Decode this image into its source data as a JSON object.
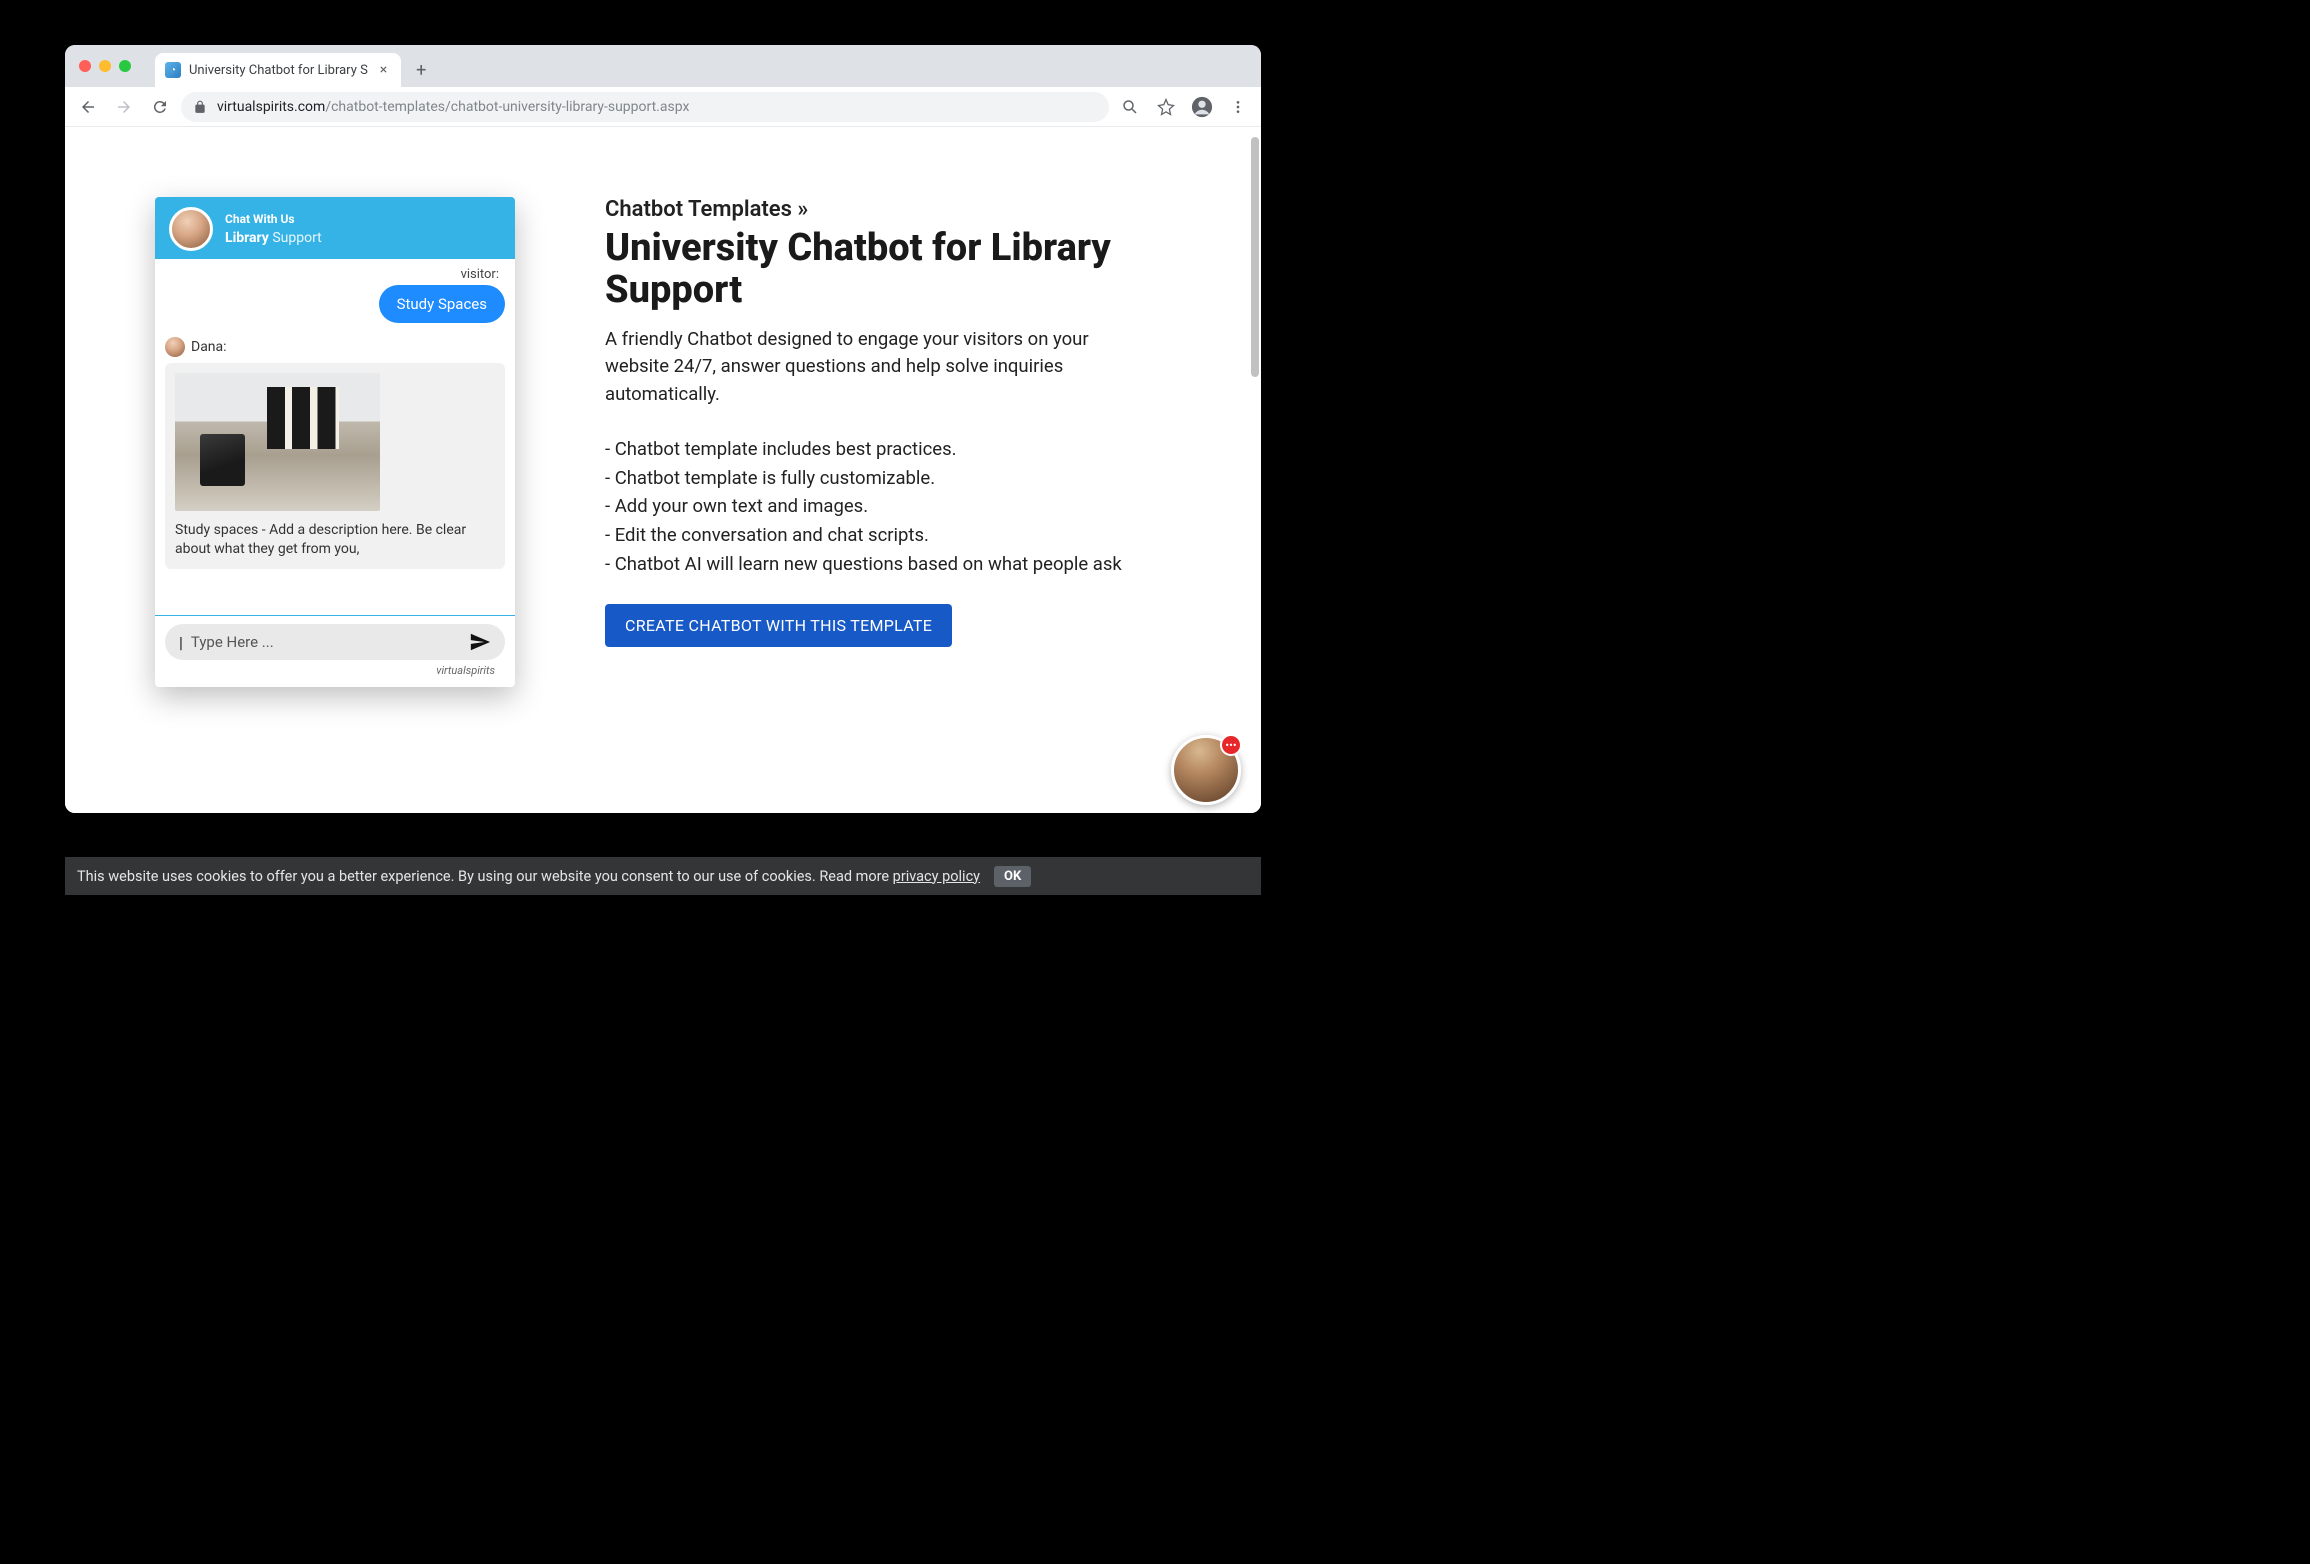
{
  "browser": {
    "tab_title": "University Chatbot for Library S",
    "url_domain": "virtualspirits.com",
    "url_path": "/chatbot-templates/chatbot-university-library-support.aspx"
  },
  "chat": {
    "chat_with": "Chat With Us",
    "subtitle_bold": "Library",
    "subtitle_rest": " Support",
    "visitor_label": "visitor:",
    "visitor_bubble": "Study Spaces",
    "bot_name": "Dana:",
    "bot_message": "Study spaces - Add a description here. Be clear about what they get from you,",
    "placeholder": "Type Here ...",
    "footer": "virtualspirits"
  },
  "page": {
    "breadcrumb": "Chatbot Templates »",
    "title": "University Chatbot for Library Support",
    "description": "A friendly Chatbot designed to engage your visitors on your website 24/7, answer questions and help solve inquiries automatically.",
    "bullets": [
      "- Chatbot template includes best practices.",
      "- Chatbot template is fully customizable.",
      "- Add your own text and images.",
      "- Edit the conversation and chat scripts.",
      "- Chatbot AI will learn new questions based on what people ask"
    ],
    "cta": "CREATE CHATBOT WITH THIS TEMPLATE"
  },
  "cookie": {
    "text_a": "This website uses cookies to offer you a better experience. By using our website you consent to our use of cookies. Read more ",
    "link": "privacy policy",
    "ok": "OK"
  }
}
